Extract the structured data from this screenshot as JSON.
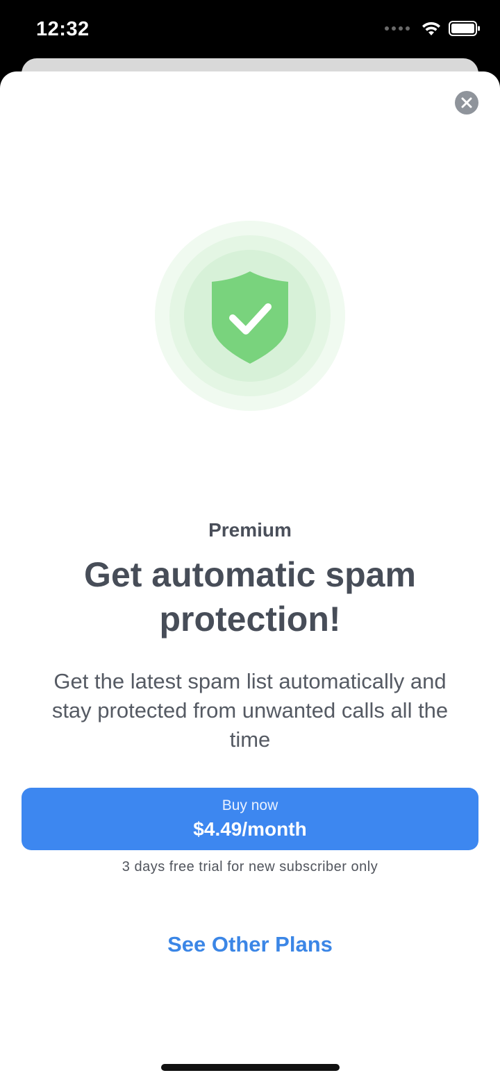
{
  "status_bar": {
    "time": "12:32",
    "icons": [
      "cellular-icon",
      "wifi-icon",
      "battery-icon"
    ]
  },
  "paywall": {
    "close_icon": "close-icon",
    "hero_icon": "shield-check-icon",
    "kicker": "Premium",
    "headline": "Get automatic spam protection!",
    "description": "Get the latest spam list automatically and stay protected from unwanted calls all the time",
    "buy_label": "Buy now",
    "buy_price": "$4.49/month",
    "trial_note": "3 days free trial for new subscriber only",
    "other_plans": "See Other Plans"
  },
  "colors": {
    "accent": "#3d87f0",
    "link": "#3b86e6",
    "shield": "#79d37d",
    "text_dark": "#474d58"
  }
}
